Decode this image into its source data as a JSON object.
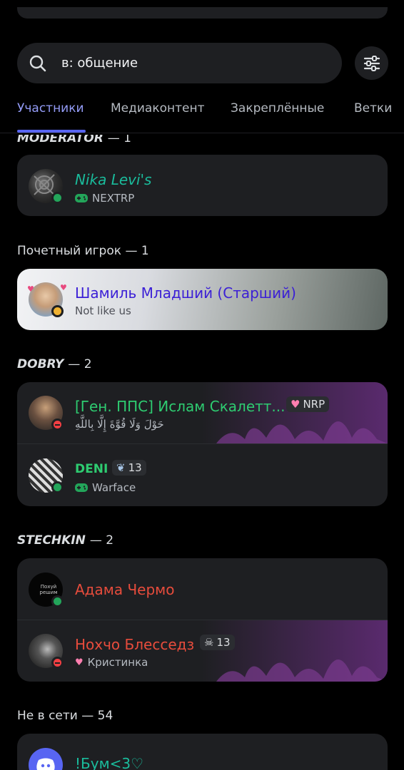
{
  "search": {
    "value": "в: общение"
  },
  "tabs": [
    {
      "label": "Участники"
    },
    {
      "label": "Медиаконтент"
    },
    {
      "label": "Закреплённые"
    },
    {
      "label": "Ветки"
    }
  ],
  "sections": {
    "moderator": {
      "title": "MODERATOR",
      "count": "— 1"
    },
    "honored": {
      "title": "Почетный игрок",
      "count": "— 1"
    },
    "dobry": {
      "title": "DOBRY",
      "count": "— 2"
    },
    "stechkin": {
      "title": "STECHKIN",
      "count": "— 2"
    },
    "offline": {
      "title": "Не в сети",
      "count": "— 54"
    }
  },
  "members": {
    "nika": {
      "name": "Nika Levi's",
      "activity": "NEXTRP",
      "status": "online",
      "color": "#1abc9c"
    },
    "shamil": {
      "name": "Шамиль Младший (Старший)",
      "activity": "Not like us",
      "status": "idle",
      "color": "#3b1fd6"
    },
    "islam": {
      "name": "[Ген. ППС] Ислам Скалетт...",
      "activity": "حَوْلَ وَلَا قُوَّةَ إِلَّا بِاللَّهِ",
      "status": "dnd",
      "color": "#2ecc71",
      "tag": "NRP"
    },
    "deni": {
      "name": "DENI",
      "activity": "Warface",
      "status": "online",
      "color": "#2ecc71",
      "tag": "13"
    },
    "adama": {
      "name": "Адама Чермо",
      "status": "online",
      "color": "#e74c3c",
      "avatar_text": "Похуй решим"
    },
    "nokhcho": {
      "name": "Нохчо Блесседз",
      "activity": "Кристинка",
      "status": "dnd",
      "color": "#e74c3c",
      "tag": "13"
    },
    "bum": {
      "name": "!Бум<3♡",
      "color": "#1abc9c"
    }
  }
}
